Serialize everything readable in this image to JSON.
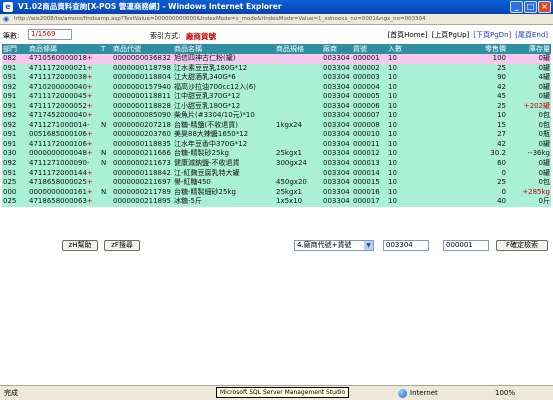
{
  "window": {
    "title": "V1.02商品資料查詢[X-POS 營運商務網] - Windows Internet Explorer",
    "min": "_",
    "max": "□",
    "close": "×"
  },
  "address": {
    "url": "http://wis2008/tw/amoss/findsamp.asp?TextValue=000000000000&IndexMode=x_mode&tIndexMode=Value=1_xdnoexx_no=0001&ngx_no=003304"
  },
  "toolbar": {
    "record_label": "筆數:",
    "record_value": "1/1569",
    "sort_label": "索引方式:",
    "sort_value": "廠商貨號",
    "nav_home": "[首頁Home]",
    "nav_pgup": "[上頁PgUp]",
    "nav_pgdn": "[下頁PgDn]",
    "nav_end": "[尾頁End]"
  },
  "table": {
    "headers": [
      "部門",
      "商品條碼",
      "T",
      "商品代號",
      "商品名稱",
      "商品規格",
      "廠商",
      "貨號",
      "入數",
      "零售價",
      "庫存量"
    ],
    "rows": [
      {
        "dept": "082",
        "barcode": "4710560000018",
        "mark": "+",
        "t": "",
        "code": "0000000036832",
        "name": "旭信四神古仁粉(罐)",
        "spec": "",
        "vendor": "003304",
        "no": "000001",
        "qty": "10",
        "price": "100",
        "stock": "0罐"
      },
      {
        "dept": "091",
        "barcode": "4711172000021",
        "mark": "+",
        "t": "",
        "code": "0000000118798",
        "name": "江水素豆豆乳180G*12",
        "spec": "",
        "vendor": "003304",
        "no": "000002",
        "qty": "10",
        "price": "25",
        "stock": "0罐"
      },
      {
        "dept": "091",
        "barcode": "4711172000038",
        "mark": "+",
        "t": "",
        "code": "0000000118804",
        "name": "江大甜酒乳340G*6",
        "spec": "",
        "vendor": "003304",
        "no": "000003",
        "qty": "10",
        "price": "90",
        "stock": "4罐"
      },
      {
        "dept": "092",
        "barcode": "4710200000040",
        "mark": "+",
        "t": "",
        "code": "0000000157940",
        "name": "福高沙拉油700cc12入(6)",
        "spec": "",
        "vendor": "003304",
        "no": "000004",
        "qty": "10",
        "price": "42",
        "stock": "0罐"
      },
      {
        "dept": "091",
        "barcode": "4711172000045",
        "mark": "+",
        "t": "",
        "code": "0000000118811",
        "name": "江中甜豆乳370G*12",
        "spec": "",
        "vendor": "003304",
        "no": "000005",
        "qty": "10",
        "price": "45",
        "stock": "0罐"
      },
      {
        "dept": "091",
        "barcode": "4711172000052",
        "mark": "+",
        "t": "",
        "code": "0000000118828",
        "name": "江小甜豆乳180G*12",
        "spec": "",
        "vendor": "003304",
        "no": "000006",
        "qty": "10",
        "price": "25",
        "stock": "+202罐"
      },
      {
        "dept": "092",
        "barcode": "4717452000040",
        "mark": "+",
        "t": "",
        "code": "0000000085090",
        "name": "柴魚片(#3304/10元)*10",
        "spec": "",
        "vendor": "003304",
        "no": "000007",
        "qty": "10",
        "price": "10",
        "stock": "0包"
      },
      {
        "dept": "092",
        "barcode": "4711271000014",
        "mark": "-",
        "t": "N",
        "code": "0000000207218",
        "name": "台糖-精鹽(不收退貨)",
        "spec": "1kgx24",
        "vendor": "003304",
        "no": "000008",
        "qty": "10",
        "price": "15",
        "stock": "0包"
      },
      {
        "dept": "091",
        "barcode": "0051685000106",
        "mark": "+",
        "t": "",
        "code": "0000000203760",
        "name": "美昊88大辣醬1650*12",
        "spec": "",
        "vendor": "003304",
        "no": "000010",
        "qty": "10",
        "price": "27",
        "stock": "0瓶"
      },
      {
        "dept": "091",
        "barcode": "4711172000106",
        "mark": "+",
        "t": "",
        "code": "0000000118835",
        "name": "江水年豆香中370G*12",
        "spec": "",
        "vendor": "003304",
        "no": "000011",
        "qty": "10",
        "price": "42",
        "stock": "0罐"
      },
      {
        "dept": "030",
        "barcode": "0000000000048",
        "mark": "+",
        "t": "N",
        "code": "0000000211666",
        "name": "台糖-精製砂25kg",
        "spec": "25kgx1",
        "vendor": "003304",
        "no": "000012",
        "qty": "10",
        "price": "30.2",
        "stock": "--36kg"
      },
      {
        "dept": "092",
        "barcode": "4711271000090",
        "mark": "-",
        "t": "N",
        "code": "0000000211673",
        "name": "健康減鈉鹽-不收退貨",
        "spec": "300gx24",
        "vendor": "003304",
        "no": "000013",
        "qty": "10",
        "price": "60",
        "stock": "0罐"
      },
      {
        "dept": "091",
        "barcode": "4711172000144",
        "mark": "+",
        "t": "",
        "code": "0000000118842",
        "name": "江-紅麴豆腐乳特大罐",
        "spec": "",
        "vendor": "003304",
        "no": "000014",
        "qty": "10",
        "price": "0",
        "stock": "0罐"
      },
      {
        "dept": "025",
        "barcode": "4718658000025",
        "mark": "+",
        "t": "",
        "code": "0000000211697",
        "name": "譽-紅糖450",
        "spec": "450gx20",
        "vendor": "003304",
        "no": "000015",
        "qty": "10",
        "price": "25",
        "stock": "0包"
      },
      {
        "dept": "000",
        "barcode": "0000000000161",
        "mark": "+",
        "t": "N",
        "code": "0000000211789",
        "name": "台糖-精製細砂25kg",
        "spec": "25kgx1",
        "vendor": "003304",
        "no": "000016",
        "qty": "10",
        "price": "0",
        "stock": "+285kg"
      },
      {
        "dept": "025",
        "barcode": "4718658000063",
        "mark": "+",
        "t": "",
        "code": "0000000211895",
        "name": "冰糖-5斤",
        "spec": "1x5x10",
        "vendor": "003304",
        "no": "000017",
        "qty": "10",
        "price": "40",
        "stock": "0斤"
      }
    ]
  },
  "controls": {
    "help_button": "zH幫助",
    "search_button": "zF搜尋",
    "index_select": "4.廠商代號+貨號",
    "vendor_field": "003304",
    "item_field": "000001",
    "confirm_button": "F確定檢索"
  },
  "status": {
    "done": "完成",
    "tooltip": "Microsoft SQL Server Management Studio",
    "zone": "Internet",
    "zoom": "100%"
  }
}
